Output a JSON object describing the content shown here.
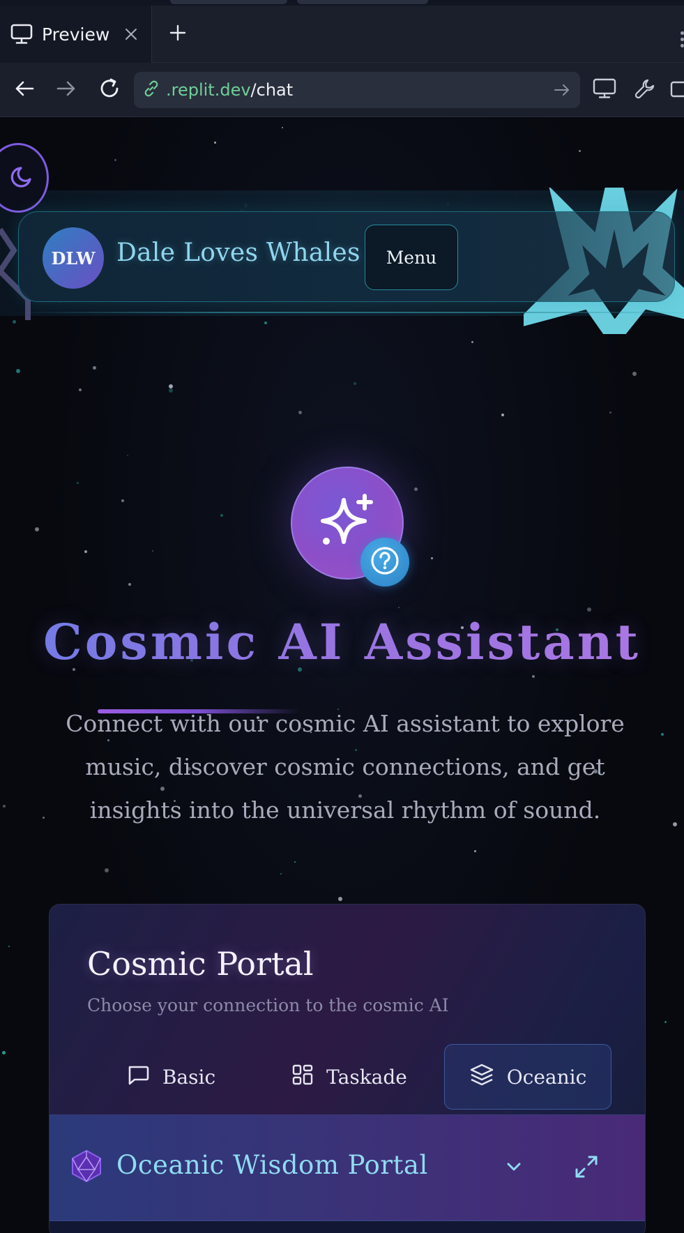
{
  "browser": {
    "tab_title": "Preview",
    "url_domain": ".replit.dev",
    "url_path": "/chat",
    "icons": [
      "monitor-icon",
      "close-icon",
      "plus-icon",
      "back-arrow-icon",
      "forward-arrow-icon",
      "reload-icon",
      "link-icon",
      "go-arrow-icon",
      "wrench-icon",
      "external-icon"
    ]
  },
  "header": {
    "logo_text": "DLW",
    "brand_name": "Dale Loves Whales",
    "menu_label": "Menu",
    "theme_toggle_icon": "moon-icon"
  },
  "hero": {
    "icon": "sparkles-icon",
    "badge_icon": "help-circle-icon",
    "title": "Cosmic AI Assistant",
    "description": "Connect with our cosmic AI assistant to explore music, discover cosmic connections, and get insights into the universal rhythm of sound."
  },
  "portal": {
    "title": "Cosmic Portal",
    "subtitle": "Choose your connection to the cosmic AI",
    "tabs": [
      {
        "label": "Basic",
        "icon": "chat-bubble-icon",
        "active": false
      },
      {
        "label": "Taskade",
        "icon": "layout-grid-icon",
        "active": false
      },
      {
        "label": "Oceanic",
        "icon": "layers-icon",
        "active": true
      }
    ],
    "section_title": "Oceanic Wisdom Portal",
    "section_icon": "geodesic-gem-icon"
  },
  "colors": {
    "accent_purple": "#9b5de5",
    "accent_cyan": "#8fdcf2",
    "url_green": "#6fcf97"
  }
}
